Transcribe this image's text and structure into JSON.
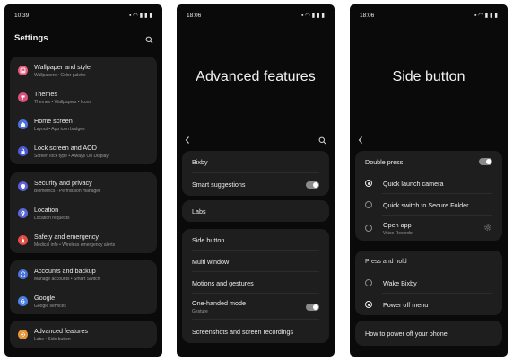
{
  "screens": {
    "settings": {
      "time": "10:39",
      "title": "Settings",
      "groups": [
        {
          "items": [
            {
              "label": "Wallpaper and style",
              "sub": "Wallpapers • Color palette",
              "icon": "wallpaper-icon",
              "color": "#e55a7e"
            },
            {
              "label": "Themes",
              "sub": "Themes • Wallpapers • Icons",
              "icon": "themes-icon",
              "color": "#d9507a"
            },
            {
              "label": "Home screen",
              "sub": "Layout • App icon badges",
              "icon": "home-icon",
              "color": "#4d6fe0"
            },
            {
              "label": "Lock screen and AOD",
              "sub": "Screen lock type • Always On Display",
              "icon": "lock-icon",
              "color": "#4a5ad6"
            }
          ]
        },
        {
          "items": [
            {
              "label": "Security and privacy",
              "sub": "Biometrics • Permission manager",
              "icon": "shield-icon",
              "color": "#5b5fd8"
            },
            {
              "label": "Location",
              "sub": "Location requests",
              "icon": "location-icon",
              "color": "#5b67d6"
            },
            {
              "label": "Safety and emergency",
              "sub": "Medical info • Wireless emergency alerts",
              "icon": "emergency-icon",
              "color": "#e04d45"
            }
          ]
        },
        {
          "items": [
            {
              "label": "Accounts and backup",
              "sub": "Manage accounts • Smart Switch",
              "icon": "accounts-icon",
              "color": "#4a72db"
            },
            {
              "label": "Google",
              "sub": "Google services",
              "icon": "google-icon",
              "color": "#4a80e8"
            }
          ]
        },
        {
          "items": [
            {
              "label": "Advanced features",
              "sub": "Labs • Side button",
              "icon": "advanced-features-icon",
              "color": "#e6963a"
            }
          ]
        }
      ]
    },
    "advanced": {
      "time": "18:06",
      "title": "Advanced features",
      "groups": [
        {
          "items": [
            {
              "label": "Bixby"
            },
            {
              "label": "Smart suggestions",
              "toggle": true
            }
          ]
        },
        {
          "items": [
            {
              "label": "Labs"
            }
          ]
        },
        {
          "items": [
            {
              "label": "Side button"
            },
            {
              "label": "Multi window"
            },
            {
              "label": "Motions and gestures"
            },
            {
              "label": "One-handed mode",
              "sub": "Gesture",
              "toggle": true
            },
            {
              "label": "Screenshots and screen recordings"
            }
          ]
        }
      ]
    },
    "side_button": {
      "time": "18:06",
      "title": "Side button",
      "double_press": {
        "label": "Double press",
        "toggle": true,
        "options": [
          {
            "label": "Quick launch camera",
            "selected": true
          },
          {
            "label": "Quick switch to Secure Folder",
            "selected": false
          },
          {
            "label": "Open app",
            "sub": "Voice Recorder",
            "selected": false
          }
        ]
      },
      "press_and_hold": {
        "label": "Press and hold",
        "options": [
          {
            "label": "Wake Bixby",
            "selected": false
          },
          {
            "label": "Power off menu",
            "selected": true
          }
        ]
      },
      "help_link": "How to power off your phone"
    }
  },
  "colors": {
    "screen_bg": "#0a0a0a",
    "card_bg": "#1e1e1e",
    "toggle_track": "#8a8a8a"
  }
}
